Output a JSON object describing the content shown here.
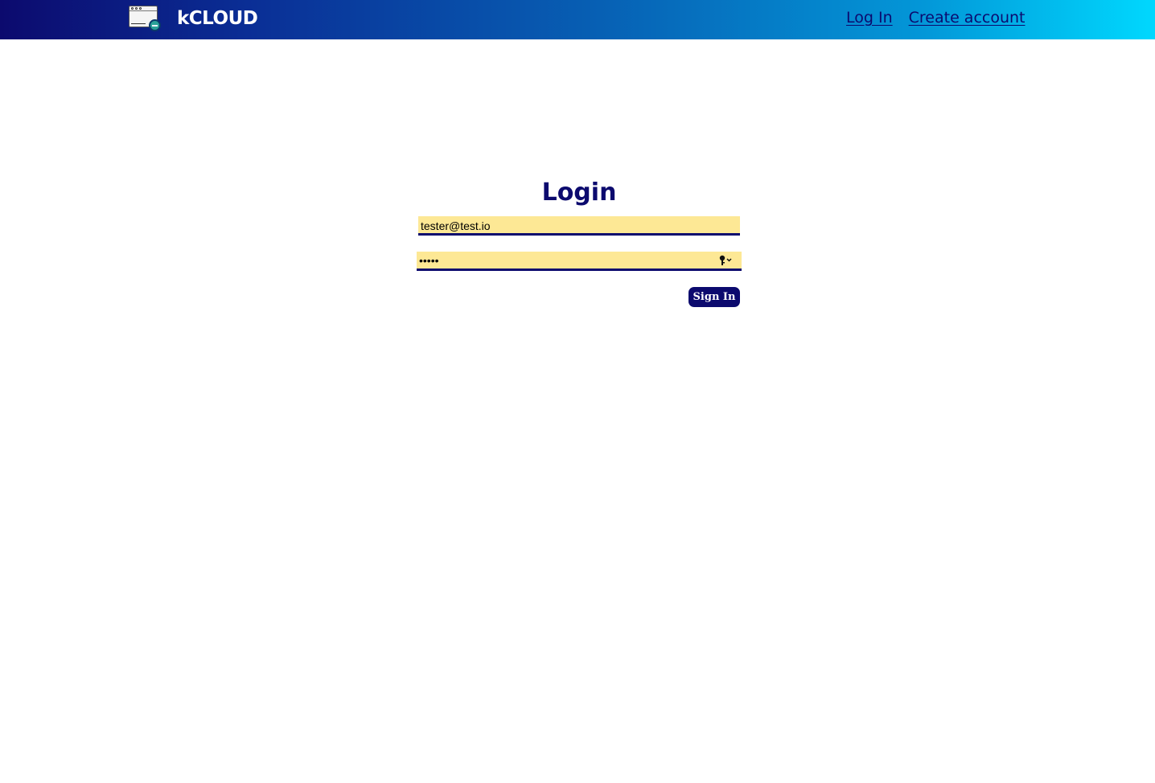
{
  "header": {
    "brand_name": "kCLOUD",
    "nav": [
      {
        "label": "Log In"
      },
      {
        "label": "Create account"
      }
    ]
  },
  "login": {
    "title": "Login",
    "email_value": "tester@test.io",
    "password_value": "•••••",
    "submit_label": "Sign In"
  },
  "icons": {
    "logo": "browser-window-logo-icon",
    "password_manager": "key-icon"
  },
  "colors": {
    "primary": "#0c0a6e",
    "autofill_background": "#fde895",
    "gradient_start": "#0c0a6e",
    "gradient_end": "#00d8fe"
  }
}
